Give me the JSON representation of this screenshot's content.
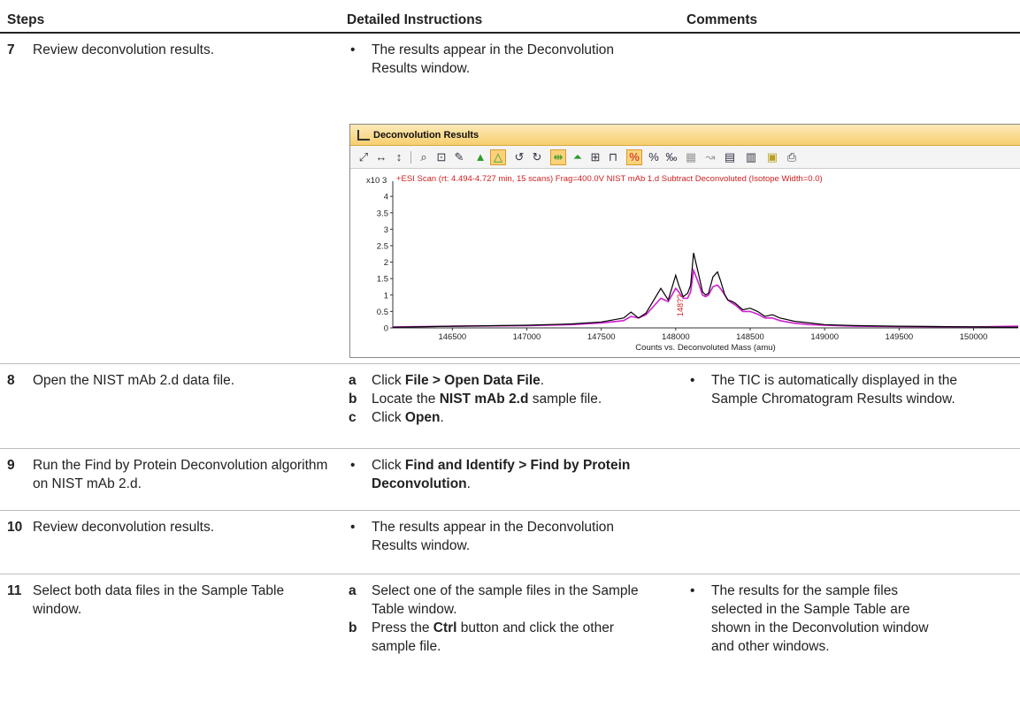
{
  "header": {
    "steps": "Steps",
    "instructions": "Detailed Instructions",
    "comments": "Comments"
  },
  "rows": [
    {
      "num": "7",
      "step": "Review deconvolution results.",
      "instructions": [
        {
          "marker": "•",
          "parts": [
            "The results appear in the Deconvolution Results window."
          ]
        }
      ],
      "comments": []
    },
    {
      "num": "8",
      "step": "Open the NIST mAb 2.d data file.",
      "instructions": [
        {
          "marker": "a",
          "parts": [
            "Click ",
            "File > Open Data File",
            "."
          ]
        },
        {
          "marker": "b",
          "parts": [
            "Locate the ",
            "NIST mAb 2.d",
            " sample file."
          ]
        },
        {
          "marker": "c",
          "parts": [
            "Click ",
            "Open",
            "."
          ]
        }
      ],
      "comments": [
        {
          "marker": "•",
          "text": "The TIC is automatically displayed in the Sample Chromatogram Results window."
        }
      ]
    },
    {
      "num": "9",
      "step": "Run the Find by Protein Deconvolution algorithm on NIST mAb 2.d.",
      "instructions": [
        {
          "marker": "•",
          "parts": [
            "Click ",
            "Find and Identify > Find by Protein Deconvolution",
            "."
          ]
        }
      ],
      "comments": []
    },
    {
      "num": "10",
      "step": "Review deconvolution results.",
      "instructions": [
        {
          "marker": "•",
          "parts": [
            "The results appear in the Deconvolution Results window."
          ]
        }
      ],
      "comments": []
    },
    {
      "num": "11",
      "step": "Select both data files in the Sample Table window.",
      "instructions": [
        {
          "marker": "a",
          "parts": [
            "Select one of the sample files in the Sample Table window."
          ]
        },
        {
          "marker": "b",
          "parts": [
            "Press the ",
            "Ctrl",
            " button and click the other sample file."
          ]
        }
      ],
      "comments": [
        {
          "marker": "•",
          "text": "The results for the sample files selected in the Sample Table are shown in the Deconvolution window and other windows."
        }
      ]
    }
  ],
  "window": {
    "title": "Deconvolution Results",
    "toolbar_icons": [
      "expand-icon",
      "pan-x-icon",
      "pan-y-icon",
      "zoom-icon",
      "autoscale-icon",
      "peak-label-icon",
      "find-peaks-icon",
      "integrate-icon",
      "undo-icon",
      "redo-icon",
      "fit-x-icon",
      "peak-icon",
      "compare-icon",
      "overlay-icon",
      "normalize-icon",
      "percent-icon",
      "relative-percent-icon",
      "table-icon",
      "arrow-icon",
      "report-icon",
      "bar-chart-icon",
      "copy-icon",
      "print-icon"
    ]
  },
  "chart_data": {
    "type": "line",
    "title": "+ESI Scan (rt: 4.494-4.727 min, 15 scans) Frag=400.0V NIST mAb 1.d  Subtract Deconvoluted (Isotope Width=0.0)",
    "y_multiplier": "x10 3",
    "xlabel": "Counts vs. Deconvoluted Mass (amu)",
    "ylabel": "",
    "xlim": [
      146100,
      150300
    ],
    "ylim": [
      0,
      4.3
    ],
    "x_ticks": [
      "146500",
      "147000",
      "147500",
      "148000",
      "148500",
      "149000",
      "149500",
      "150000"
    ],
    "y_ticks": [
      "0",
      "0.5",
      "1",
      "1.5",
      "2",
      "2.5",
      "3",
      "3.5",
      "4"
    ],
    "annotation": "148??",
    "series": [
      {
        "color": "#000000",
        "x": [
          146100,
          146500,
          147000,
          147300,
          147500,
          147650,
          147700,
          147750,
          147800,
          147900,
          147950,
          148000,
          148020,
          148050,
          148080,
          148100,
          148120,
          148150,
          148180,
          148200,
          148220,
          148250,
          148280,
          148300,
          148330,
          148350,
          148380,
          148400,
          148450,
          148500,
          148550,
          148600,
          148650,
          148700,
          148750,
          148800,
          148900,
          149000,
          149200,
          149500,
          150000,
          150300
        ],
        "y": [
          0.02,
          0.05,
          0.08,
          0.12,
          0.18,
          0.3,
          0.48,
          0.3,
          0.45,
          1.2,
          0.85,
          1.6,
          1.3,
          0.95,
          1.05,
          1.3,
          2.28,
          1.7,
          1.1,
          1.0,
          1.05,
          1.55,
          1.7,
          1.45,
          1.0,
          0.85,
          0.8,
          0.75,
          0.55,
          0.6,
          0.5,
          0.35,
          0.4,
          0.3,
          0.25,
          0.2,
          0.15,
          0.1,
          0.07,
          0.05,
          0.03,
          0.02
        ]
      },
      {
        "color": "#d020d0",
        "x": [
          146100,
          146500,
          147000,
          147300,
          147500,
          147650,
          147700,
          147750,
          147800,
          147900,
          147950,
          148000,
          148020,
          148050,
          148080,
          148100,
          148120,
          148150,
          148180,
          148200,
          148220,
          148250,
          148280,
          148300,
          148330,
          148350,
          148380,
          148400,
          148450,
          148500,
          148550,
          148600,
          148650,
          148700,
          148750,
          148800,
          148900,
          149000,
          149200,
          149500,
          150000,
          150300
        ],
        "y": [
          0.03,
          0.05,
          0.07,
          0.1,
          0.15,
          0.22,
          0.35,
          0.3,
          0.4,
          0.9,
          0.8,
          1.2,
          1.1,
          0.9,
          0.9,
          1.1,
          1.75,
          1.4,
          1.0,
          0.95,
          1.0,
          1.25,
          1.3,
          1.2,
          1.0,
          0.85,
          0.75,
          0.7,
          0.5,
          0.5,
          0.42,
          0.3,
          0.3,
          0.22,
          0.18,
          0.14,
          0.1,
          0.08,
          0.05,
          0.04,
          0.03,
          0.05
        ]
      }
    ]
  }
}
